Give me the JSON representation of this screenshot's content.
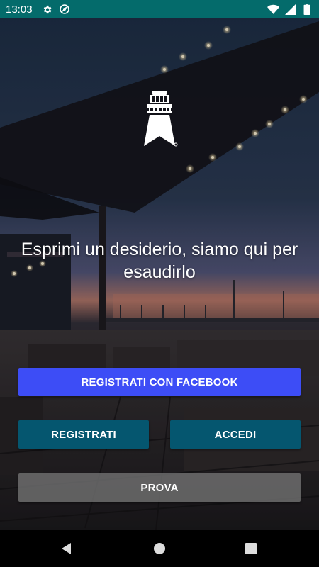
{
  "status_bar": {
    "time": "13:03",
    "left_icons": [
      "gear-icon",
      "do-not-disturb-icon"
    ],
    "right_icons": [
      "wifi-icon",
      "signal-icon",
      "battery-icon"
    ],
    "background_color": "#046b6b"
  },
  "logo": {
    "icon": "lighthouse-logo"
  },
  "tagline": "Esprimi un desiderio, siamo qui per esaudirlo",
  "buttons": {
    "facebook_label": "REGISTRATI CON FACEBOOK",
    "register_label": "REGISTRATI",
    "login_label": "ACCEDI",
    "try_label": "PROVA"
  },
  "colors": {
    "facebook": "#3d4df6",
    "primary": "#05566f",
    "secondary": "#787878"
  },
  "nav_bar": {
    "icons": [
      "back-icon",
      "home-icon",
      "recents-icon"
    ]
  }
}
